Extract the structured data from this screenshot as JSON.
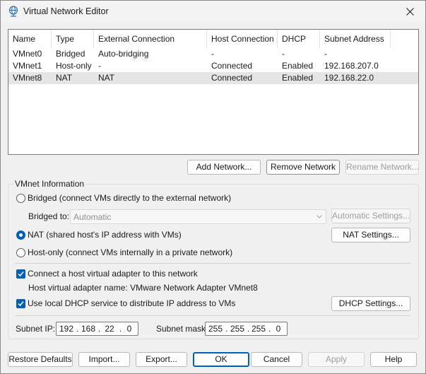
{
  "window": {
    "title": "Virtual Network Editor"
  },
  "network_list": {
    "columns": [
      "Name",
      "Type",
      "External Connection",
      "Host Connection",
      "DHCP",
      "Subnet Address"
    ],
    "rows": [
      [
        "VMnet0",
        "Bridged",
        "Auto-bridging",
        "-",
        "-",
        "-"
      ],
      [
        "VMnet1",
        "Host-only",
        "-",
        "Connected",
        "Enabled",
        "192.168.207.0"
      ],
      [
        "VMnet8",
        "NAT",
        "NAT",
        "Connected",
        "Enabled",
        "192.168.22.0"
      ]
    ],
    "selected_row": 2
  },
  "list_buttons": {
    "add": "Add Network...",
    "remove": "Remove Network",
    "rename": "Rename Network..."
  },
  "vmnet_info": {
    "group_label": "VMnet Information",
    "bridged_label": "Bridged (connect VMs directly to the external network)",
    "bridged_to_label": "Bridged to:",
    "bridged_to_value": "Automatic",
    "automatic_settings": "Automatic Settings...",
    "nat_label": "NAT (shared host's IP address with VMs)",
    "nat_settings": "NAT Settings...",
    "hostonly_label": "Host-only (connect VMs internally in a private network)",
    "selected_mode": "NAT",
    "connect_adapter_label": "Connect a host virtual adapter to this network",
    "connect_adapter_checked": true,
    "adapter_name_text": "Host virtual adapter name: VMware Network Adapter VMnet8",
    "dhcp_label": "Use local DHCP service to distribute IP address to VMs",
    "dhcp_checked": true,
    "dhcp_settings": "DHCP Settings...",
    "subnet_ip_label": "Subnet IP:",
    "subnet_ip": [
      "192",
      "168",
      "22",
      "0"
    ],
    "subnet_mask_label": "Subnet mask:",
    "subnet_mask": [
      "255",
      "255",
      "255",
      "0"
    ]
  },
  "footer": {
    "restore": "Restore Defaults",
    "import": "Import...",
    "export": "Export...",
    "ok": "OK",
    "cancel": "Cancel",
    "apply": "Apply",
    "help": "Help"
  },
  "colors": {
    "accent": "#005fb8",
    "selected_row": "#e5e5e5"
  }
}
